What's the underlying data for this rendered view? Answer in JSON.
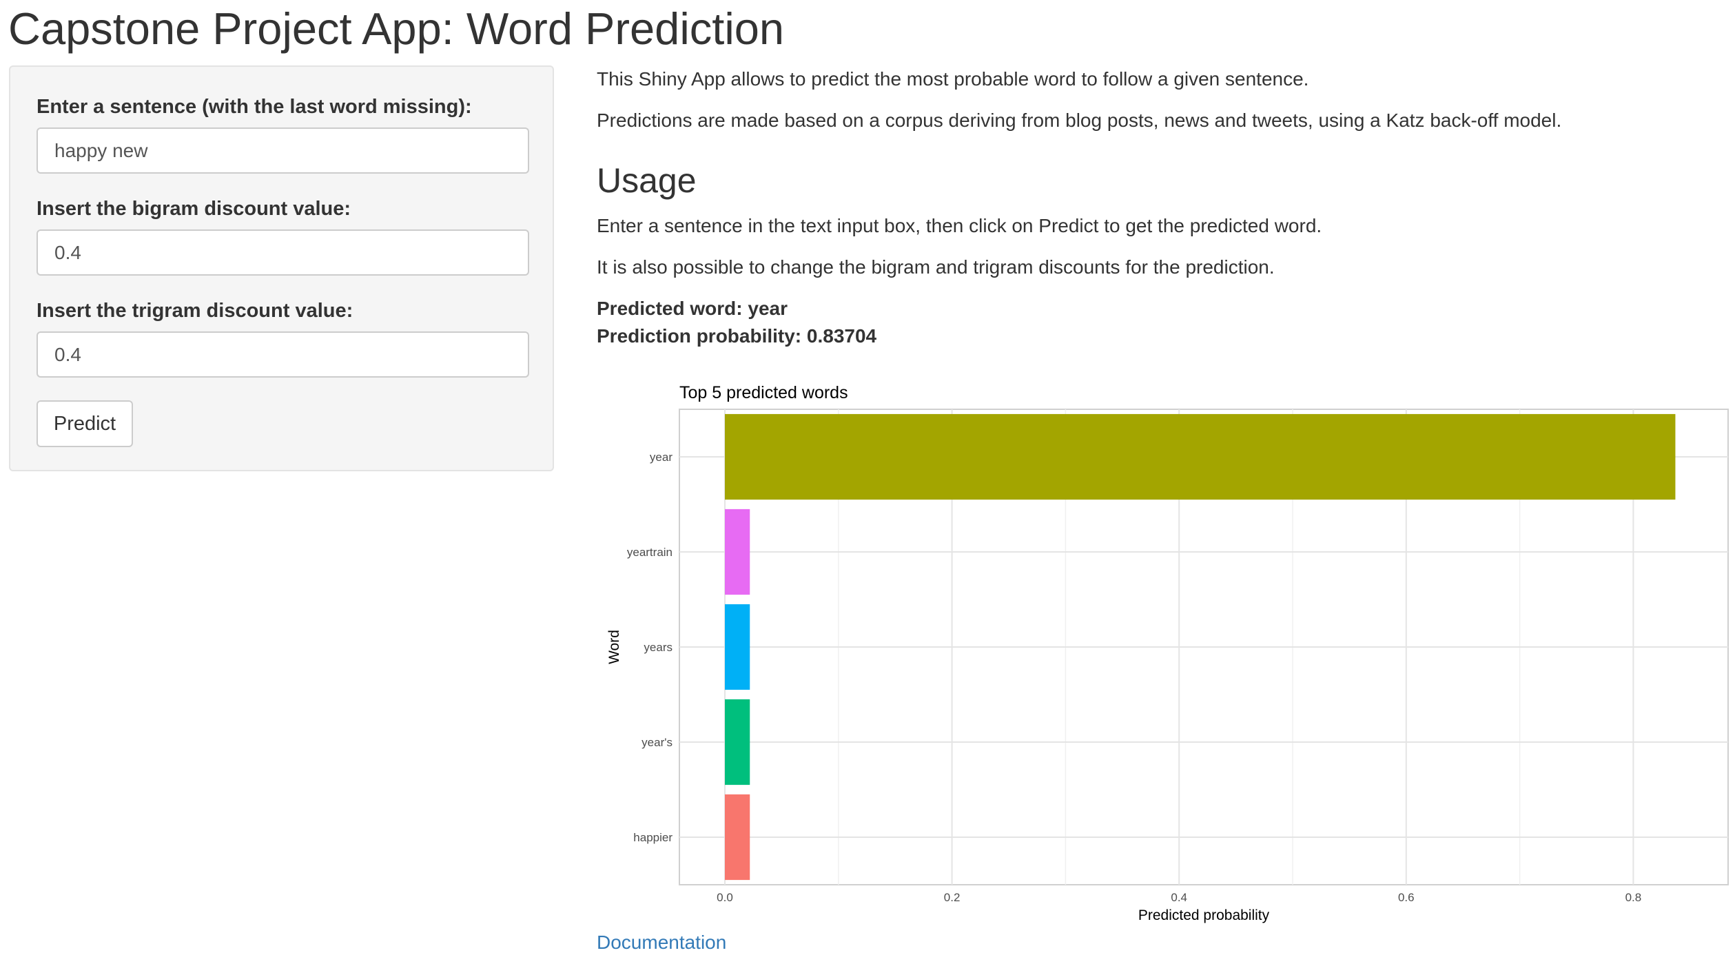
{
  "app": {
    "title": "Capstone Project App: Word Prediction"
  },
  "sidebar": {
    "sentence_label": "Enter a sentence (with the last word missing):",
    "sentence_value": "happy new",
    "bigram_label": "Insert the bigram discount value:",
    "bigram_value": "0.4",
    "trigram_label": "Insert the trigram discount value:",
    "trigram_value": "0.4",
    "predict_label": "Predict"
  },
  "main": {
    "intro_1": "This Shiny App allows to predict the most probable word to follow a given sentence.",
    "intro_2": "Predictions are made based on a corpus deriving from blog posts, news and tweets, using a Katz back-off model.",
    "usage_heading": "Usage",
    "usage_1": "Enter a sentence in the text input box, then click on Predict to get the predicted word.",
    "usage_2": "It is also possible to change the bigram and trigram discounts for the prediction.",
    "predicted_word": "Predicted word: year",
    "prediction_probability": "Prediction probability: 0.83704",
    "documentation_link": "Documentation"
  },
  "chart_data": {
    "type": "bar",
    "orientation": "horizontal",
    "title": "Top 5 predicted words",
    "xlabel": "Predicted probability",
    "ylabel": "Word",
    "xlim": [
      0,
      0.88
    ],
    "x_ticks": [
      0.0,
      0.2,
      0.4,
      0.6,
      0.8
    ],
    "x_tick_labels": [
      "0.0",
      "0.2",
      "0.4",
      "0.6",
      "0.8"
    ],
    "grid": true,
    "legend": "none",
    "categories": [
      "year",
      "yeartrain",
      "years",
      "year's",
      "happier"
    ],
    "values": [
      0.83704,
      0.022,
      0.022,
      0.022,
      0.022
    ],
    "colors": [
      "#A3A500",
      "#E76BF3",
      "#00B0F6",
      "#00BF7D",
      "#F8766D"
    ]
  }
}
